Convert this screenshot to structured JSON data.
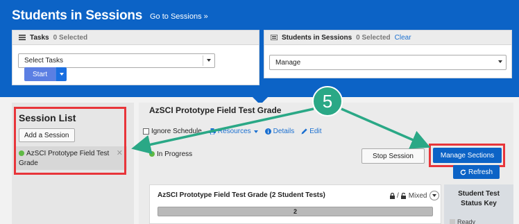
{
  "header": {
    "title": "Students in Sessions",
    "goto_link": "Go to Sessions »"
  },
  "tasks_panel": {
    "label": "Tasks",
    "count": "0 Selected",
    "select_value": "Select Tasks",
    "start_label": "Start"
  },
  "sis_panel": {
    "label": "Students in Sessions",
    "count": "0 Selected",
    "clear_label": "Clear",
    "select_value": "Manage"
  },
  "session_list": {
    "title": "Session List",
    "add_label": "Add a Session",
    "items": [
      {
        "name": "AzSCI Prototype Field Test Grade",
        "status": "active"
      }
    ]
  },
  "session": {
    "title": "AzSCI Prototype Field Test Grade",
    "ignore_schedule": "Ignore Schedule",
    "resources_label": "Resources",
    "details_label": "Details",
    "edit_label": "Edit",
    "status": "In Progress",
    "stop_label": "Stop Session",
    "manage_label": "Manage Sections",
    "refresh_label": "Refresh"
  },
  "test_group": {
    "title": "AzSCI Prototype Field Test Grade (2 Student Tests)",
    "lock_mode": "Mixed",
    "progress_value": "2",
    "progress_fraction": 1.0
  },
  "status_key": {
    "title_line1": "Student Test",
    "title_line2": "Status Key",
    "ready": "Ready"
  },
  "callout": {
    "number": "5"
  },
  "colors": {
    "header_blue": "#0c63c6",
    "highlight_red": "#e8353a",
    "callout_green": "#2aa886",
    "status_green": "#5fb944"
  }
}
